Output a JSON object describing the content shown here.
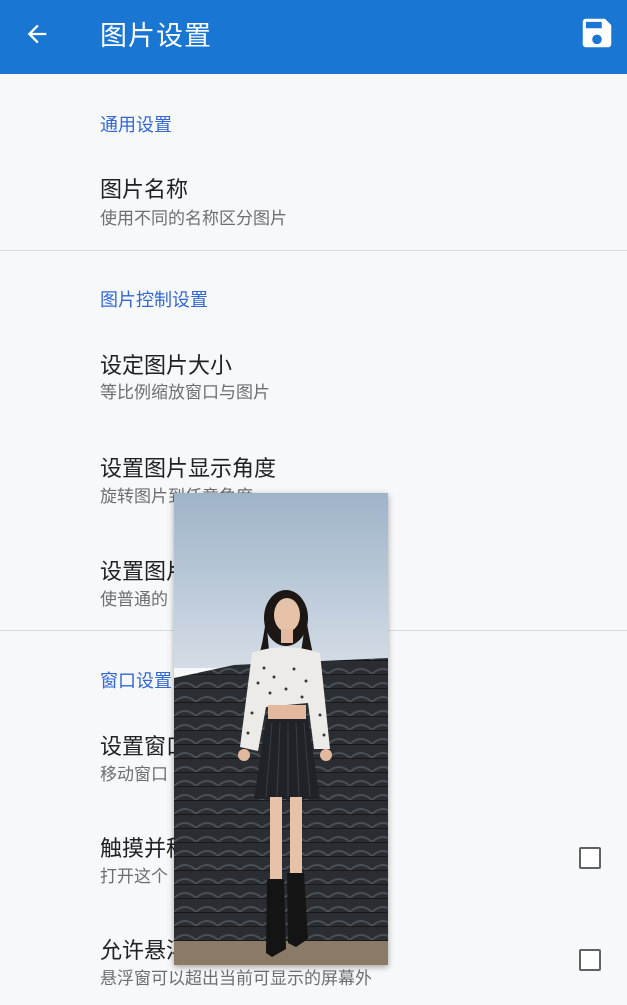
{
  "appbar": {
    "title": "图片设置",
    "back_icon": "arrow-back-icon",
    "save_icon": "floppy-disk-save-icon",
    "background": "#1976d2"
  },
  "sections": [
    {
      "header": "通用设置",
      "items": [
        {
          "title": "图片名称",
          "subtitle": "使用不同的名称区分图片"
        }
      ]
    },
    {
      "header": "图片控制设置",
      "items": [
        {
          "title": "设定图片大小",
          "subtitle": "等比例缩放窗口与图片"
        },
        {
          "title": "设置图片显示角度",
          "subtitle": "旋转图片到任意角度"
        },
        {
          "title": "设置图片",
          "subtitle": "使普通的"
        }
      ]
    },
    {
      "header": "窗口设置",
      "items": [
        {
          "title": "设置窗口",
          "subtitle": "移动窗口"
        },
        {
          "title": "触摸并移",
          "subtitle": "打开这个 片。请谨慎使用!",
          "checked": false
        },
        {
          "title": "允许悬浮",
          "subtitle": "悬浮窗可以超出当前可显示的屏幕外",
          "checked": false
        }
      ]
    }
  ],
  "overlay": {
    "description_icon": "floating-photo-window",
    "colors": {
      "sky": "#b9c8d8",
      "roof": "#2c2f33",
      "skirt": "#1f2227"
    }
  },
  "accent_color": "#3367d6"
}
